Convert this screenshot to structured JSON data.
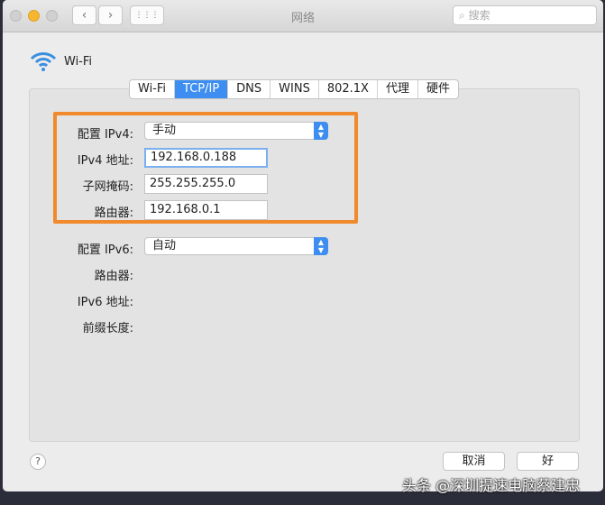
{
  "window": {
    "title": "网络",
    "search_placeholder": "搜索",
    "back": "‹",
    "forward": "›",
    "grid": "⋮⋮⋮"
  },
  "service": {
    "name": "Wi-Fi"
  },
  "tabs": [
    {
      "label": "Wi-Fi"
    },
    {
      "label": "TCP/IP",
      "active": true
    },
    {
      "label": "DNS"
    },
    {
      "label": "WINS"
    },
    {
      "label": "802.1X"
    },
    {
      "label": "代理"
    },
    {
      "label": "硬件"
    }
  ],
  "ipv4": {
    "config_label": "配置 IPv4:",
    "config_value": "手动",
    "address_label": "IPv4 地址:",
    "address": "192.168.0.188",
    "subnet_label": "子网掩码:",
    "subnet": "255.255.255.0",
    "router_label": "路由器:",
    "router": "192.168.0.1"
  },
  "ipv6": {
    "config_label": "配置 IPv6:",
    "config_value": "自动",
    "router_label": "路由器:",
    "address_label": "IPv6 地址:",
    "prefix_label": "前缀长度:"
  },
  "footer": {
    "help": "?",
    "cancel": "取消",
    "ok": "好"
  },
  "watermark": "头条 @深圳提速电脑蔡建忠",
  "colors": {
    "accent": "#3d8ef0",
    "highlight": "#f08a2c"
  }
}
